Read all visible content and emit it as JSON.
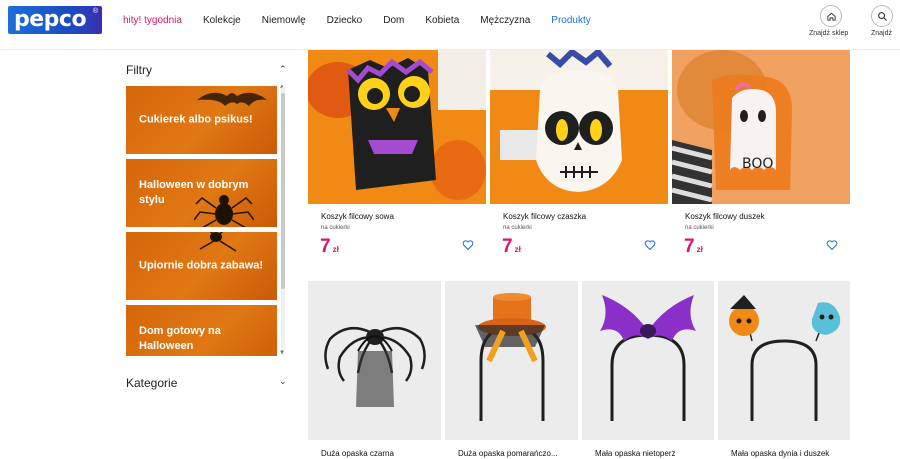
{
  "brand": {
    "logo_text": "pepco",
    "registered": "®"
  },
  "nav": [
    {
      "label": "hity! tygodnia",
      "style": "hot"
    },
    {
      "label": "Kolekcje",
      "style": ""
    },
    {
      "label": "Niemowlę",
      "style": ""
    },
    {
      "label": "Dziecko",
      "style": ""
    },
    {
      "label": "Dom",
      "style": ""
    },
    {
      "label": "Kobieta",
      "style": ""
    },
    {
      "label": "Mężczyzna",
      "style": ""
    },
    {
      "label": "Produkty",
      "style": "blue"
    }
  ],
  "header_actions": {
    "store_label": "Znajdź sklep",
    "search_label": "Znajdź"
  },
  "sidebar": {
    "filters_title": "Filtry",
    "categories_title": "Kategorie",
    "filters": [
      {
        "label": "Cukierek albo psikus!"
      },
      {
        "label": "Halloween w dobrym stylu"
      },
      {
        "label": "Upiornie dobra zabawa!"
      },
      {
        "label": "Dom gotowy na Halloween"
      }
    ]
  },
  "products_row1": [
    {
      "name": "Koszyk filcowy sowa",
      "sub": "na cukierki",
      "price": "7",
      "currency": "zł"
    },
    {
      "name": "Koszyk filcowy czaszka",
      "sub": "na cukierki",
      "price": "7",
      "currency": "zł"
    },
    {
      "name": "Koszyk filcowy duszek",
      "sub": "na cukierki",
      "price": "7",
      "currency": "zł"
    }
  ],
  "products_row2": [
    {
      "name": "Duża opaska czarna"
    },
    {
      "name": "Duża opaska pomarańczo..."
    },
    {
      "name": "Mała opaska nietoperz"
    },
    {
      "name": "Mała opaska dynia i duszek"
    }
  ],
  "colors": {
    "accent": "#d9146b",
    "brand": "#1d6fd8",
    "filter_orange": "#d86a0c"
  }
}
